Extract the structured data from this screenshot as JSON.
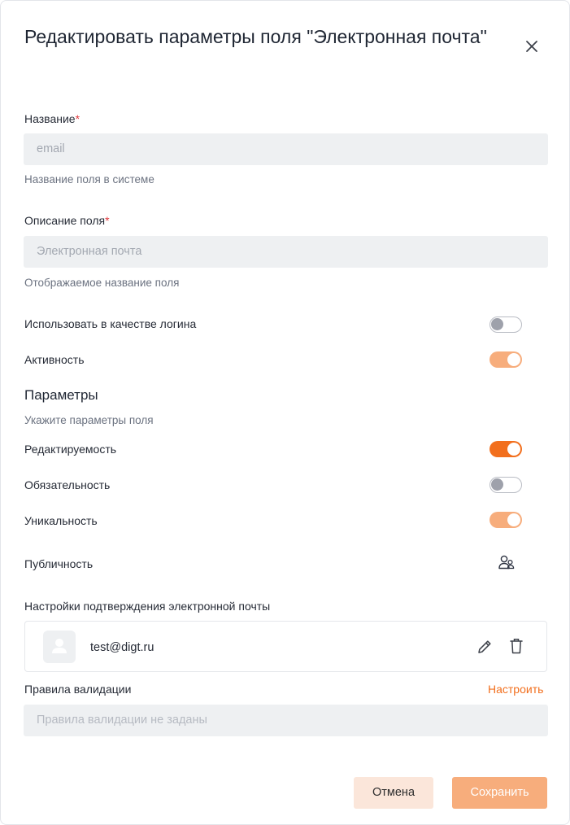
{
  "dialog": {
    "title": "Редактировать параметры поля \"Электронная почта\""
  },
  "name_field": {
    "label": "Название",
    "required_mark": "*",
    "value": "email",
    "hint": "Название поля в системе"
  },
  "description_field": {
    "label": "Описание поля",
    "required_mark": "*",
    "value": "Электронная почта",
    "hint": "Отображаемое название поля"
  },
  "toggles_top": [
    {
      "label": "Использовать в качестве логина",
      "state": "off"
    },
    {
      "label": "Активность",
      "state": "on-disabled"
    }
  ],
  "parameters": {
    "title": "Параметры",
    "subtitle": "Укажите параметры поля",
    "items": [
      {
        "label": "Редактируемость",
        "state": "on"
      },
      {
        "label": "Обязательность",
        "state": "off"
      },
      {
        "label": "Уникальность",
        "state": "on-disabled"
      }
    ],
    "publicity_label": "Публичность",
    "publicity_icon": "people-icon"
  },
  "email_confirmation": {
    "label": "Настройки подтверждения электронной почты",
    "email": "test@digt.ru",
    "icons": [
      "user-avatar-icon",
      "pencil-icon",
      "trash-icon"
    ]
  },
  "validation": {
    "label": "Правила валидации",
    "configure_link": "Настроить",
    "placeholder": "Правила валидации не заданы"
  },
  "footer": {
    "cancel_label": "Отмена",
    "save_label": "Сохранить"
  },
  "colors": {
    "accent": "#f26f1d",
    "accent_disabled": "#f7ad7c",
    "cancel_bg": "#fbe6da",
    "field_bg": "#eef0f2",
    "required": "#e0393e"
  }
}
